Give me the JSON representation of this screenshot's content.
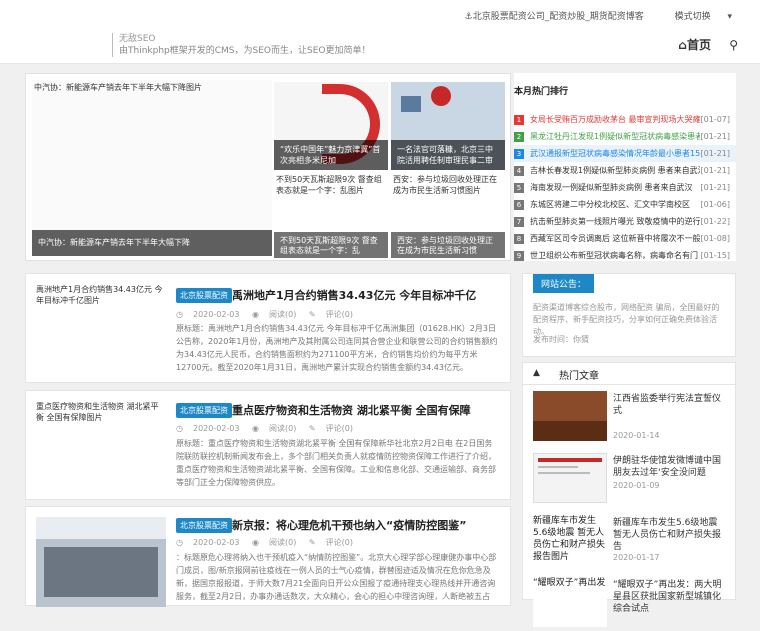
{
  "header": {
    "tagline_1": "无敌SEO",
    "tagline_2": "由Thinkphp框架开发的CMS，为SEO而生，让SEO更加简单！",
    "top_link": "北京股票配资公司_配资炒股_期货配资博客",
    "mode_switch": "模式切换",
    "nav_home": "首页"
  },
  "slider": {
    "main_caption": "中汽协：新能源车产销去年下半年大幅下降",
    "main_alt": "中汽协：新能源车产销去年下半年大幅下降图片",
    "slide2_text": "“欢乐中国年”魅力京津冀”首次亮相多米尼加",
    "slide3_text": "一名法官可落糠，北京三中院活用聘任制审理民事二审",
    "slide4_alt": "不到50天瓦斯超限9次 督查组表态就是一个字：乱图片",
    "slide4_caption": "不到50天瓦斯超限9次 督查组表态就是一个字：乱",
    "slide5_alt": "西安：参与垃圾回收处理正在成为市民生活新习惯图片",
    "slide5_caption": "西安：参与垃圾回收处理正在成为市民生活新习惯"
  },
  "hot": {
    "title": "本月热门排行",
    "items": [
      {
        "n": "1",
        "title": "女局长受贿百万成励收茅台 最审宣判现场大哭瘫倒",
        "date": "[01-07]",
        "color": "#e53935"
      },
      {
        "n": "2",
        "title": "黑龙江牡丹江发现1例疑似新型冠状病毒感染患者",
        "date": "[01-21]",
        "color": "#43a047"
      },
      {
        "n": "3",
        "title": "武汉通报新型冠状病毒感染情况年龄最小患者15岁",
        "date": "[01-21]",
        "color": "#1e88e5"
      },
      {
        "n": "4",
        "title": "吉林长春发现1例疑似新型肺炎病例 患者来自武汉",
        "date": "[01-21]",
        "color": "#777777"
      },
      {
        "n": "5",
        "title": "海南发现一例疑似新型肺炎病例 患者来自武汉",
        "date": "[01-21]",
        "color": "#777777"
      },
      {
        "n": "6",
        "title": "东城区将建二中分校北校区、汇文中学南校区",
        "date": "[01-06]",
        "color": "#777777"
      },
      {
        "n": "7",
        "title": "抗击新型肺炎第一线照片曝光 致敬疫情中的逆行者",
        "date": "[01-22]",
        "color": "#777777"
      },
      {
        "n": "8",
        "title": "西藏军区司令员调离后 这位新晋中将履次不一般",
        "date": "[01-08]",
        "color": "#777777"
      },
      {
        "n": "9",
        "title": "世卫组织公布新型冠状病毒名称，病毒命名有门",
        "date": "[01-15]",
        "color": "#777777"
      }
    ]
  },
  "articles": [
    {
      "thumb_alt": "禹洲地产1月合约销售34.43亿元 今年目标冲千亿图片",
      "tag": "北京股票配资",
      "title": "禹洲地产1月合约销售34.43亿元 今年目标冲千亿",
      "date": "2020-02-03",
      "views": "阅读(0)",
      "comments": "评论(0)",
      "excerpt": "原标题：禹洲地产1月合约销售34.43亿元 今年目标冲千亿禹洲集团（01628.HK）2月3日公告称，2020年1月份，禹洲地产及其附属公司连同其合营企业和联营公司的合约销售额约为34.43亿元人民币，合约销售面积约为271100平方米，合约销售均价约为每平方米12700元。截至2020年1月31日，禹洲地产累计实现合约销售金额约34.43亿元。"
    },
    {
      "thumb_alt": "重点医疗物资和生活物资 湖北紧平衡 全国有保障图片",
      "tag": "北京股票配资",
      "title": "重点医疗物资和生活物资 湖北紧平衡 全国有保障",
      "date": "2020-02-03",
      "views": "阅读(0)",
      "comments": "评论(0)",
      "excerpt": "原标题：重点医疗物资和生活物资湖北紧平衡 全国有保障新华社北京2月2日电 在2日国务院联防联控机制新闻发布会上，多个部门相关负责人就疫情防控物资保障工作进行了介绍，重点医疗物资和生活物资湖北紧平衡、全国有保障。工业和信息化部、交通运输部、商务部等部门正全力保障物资供应。"
    },
    {
      "thumb_alt": "新京报：将心理危机干预也纳入“疫情防控图鉴”图片",
      "tag": "北京股票配资",
      "title": "新京报：将心理危机干预也纳入“疫情防控图鉴”",
      "date": "2020-02-03",
      "views": "阅读(0)",
      "comments": "评论(0)",
      "excerpt": "：标题原危心理将纳入也干预机疫入“纳情防控图鉴”。北京大心理学部心理康健办事中心部门成员，图/新京报网前往疫线在一例人员的士气心疫情，群替图迹适及情况在危你危急及新，据国京报报道，于师大数7月21全面向日开公众国报了疫通持理支心理热线并开通咨询服务，截至2月2日，办事办通话数次，大众精心，会心的担心中理咨询理，人断绝被五占到多"
    }
  ],
  "notice": {
    "title": "网站公告：",
    "text": "配资渠道博客综合股市，网络配资 骗局，全国最好的配资程序、新手配资技巧，分享如何正确免费体验活动。",
    "date_label": "发布时间：",
    "date_value": "你猜"
  },
  "popular": {
    "title": "热门文章",
    "items": [
      {
        "title": "江西省监委举行宪法宣誓仪式",
        "date": "2020-01-14",
        "img": ""
      },
      {
        "title": "伊朗驻华使馆发微博谴中国朋友去过年‘安全没问题",
        "date": "2020-01-09",
        "img": ""
      },
      {
        "title": "新疆库车市发生5.6级地震 暂无人员伤亡和财产损失报告",
        "date": "2020-01-17",
        "img": "新疆库车市发生5.6级地震 暂无人员伤亡和财产损失报告图片"
      },
      {
        "title": "“耀眼双子”再出发：两大明星县区获批国家新型城镇化综合试点",
        "date": "",
        "img": "“耀眼双子”再出发"
      }
    ]
  },
  "icons": {
    "anchor": "anchor-icon",
    "home": "home-icon",
    "search": "search-icon",
    "arrow": "arrow-icon"
  },
  "colors": {
    "accent": "#1e88c7",
    "nav_bg": "#ffffff"
  }
}
